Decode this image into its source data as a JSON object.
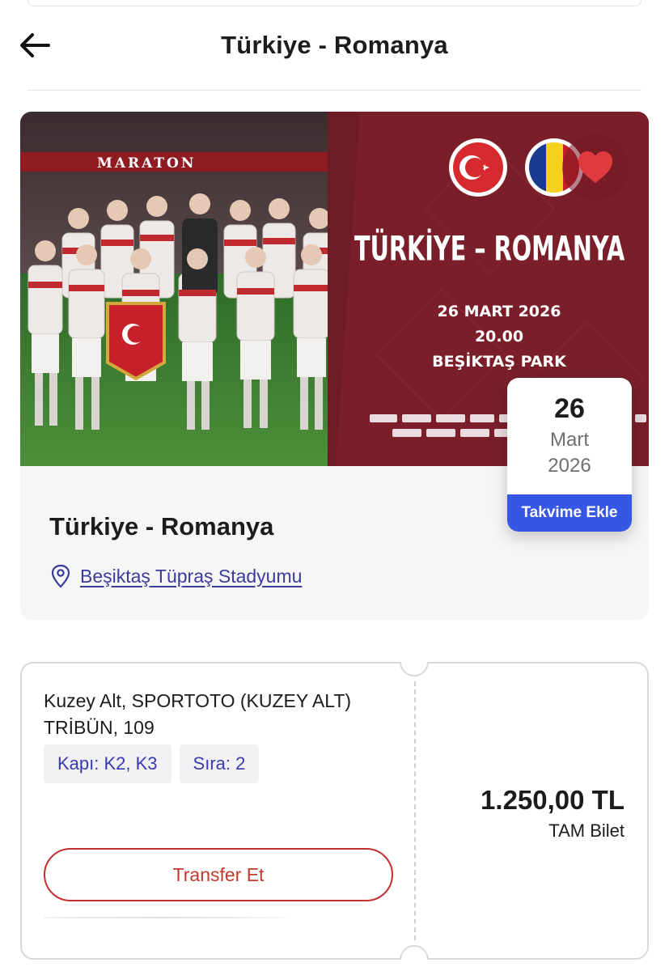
{
  "header": {
    "title": "Türkiye - Romanya",
    "back_icon": "arrow-left-icon"
  },
  "banner": {
    "stadium_sign": "MARATON",
    "poster_title": "TÜRKİYE – ROMANYA",
    "poster_date": "26 MART 2026",
    "poster_time": "20.00",
    "poster_venue": "BEŞİKTAŞ PARK",
    "favorite_icon": "heart-icon",
    "colors": {
      "poster_bg": "#7a1f2a",
      "heart": "#e0393e"
    }
  },
  "event": {
    "name": "Türkiye - Romanya",
    "venue": "Beşiktaş Tüpraş Stadyumu",
    "venue_icon": "location-pin-icon"
  },
  "date_card": {
    "day": "26",
    "month": "Mart",
    "year": "2026",
    "add_to_calendar": "Takvime Ekle",
    "accent": "#3656e6"
  },
  "ticket": {
    "seat_info": "Kuzey Alt, SPORTOTO (KUZEY ALT) TRİBÜN, 109",
    "gate": "Kapı: K2, K3",
    "row": "Sıra: 2",
    "price": "1.250,00 TL",
    "ticket_type": "TAM Bilet",
    "transfer_label": "Transfer Et",
    "transfer_color": "#c3302f"
  }
}
